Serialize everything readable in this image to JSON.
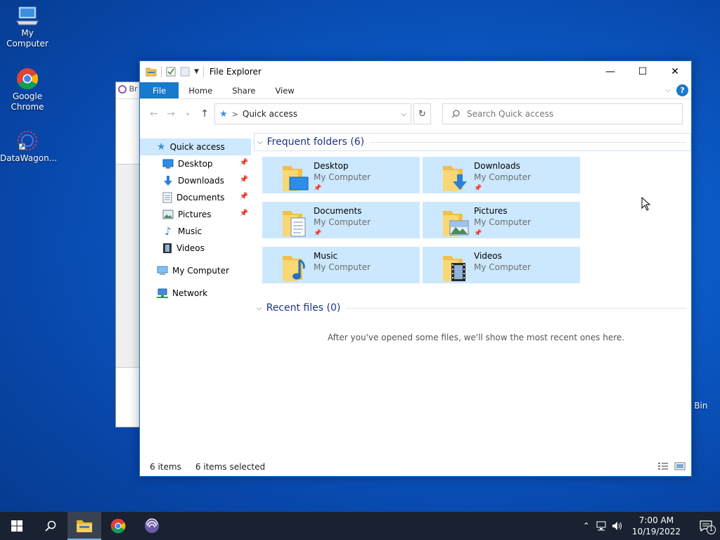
{
  "desktop": {
    "icons": [
      {
        "label": "My Computer"
      },
      {
        "label": "Google Chrome"
      },
      {
        "label": "DataWagon..."
      }
    ],
    "recycle_bin_label": "e Bin",
    "bg_window_title": "Br"
  },
  "window": {
    "title": "File Explorer",
    "controls": {
      "minimize": "—",
      "maximize": "☐",
      "close": "✕"
    },
    "ribbon_tabs": [
      "File",
      "Home",
      "Share",
      "View"
    ],
    "help": "?",
    "address": {
      "separator": ">",
      "location": "Quick access"
    },
    "search": {
      "placeholder": "Search Quick access"
    },
    "nav": {
      "items": [
        {
          "label": "Quick access",
          "icon": "star-icon",
          "selected": true
        },
        {
          "label": "Desktop",
          "icon": "desktop-icon",
          "pinned": true
        },
        {
          "label": "Downloads",
          "icon": "download-arrow-icon",
          "pinned": true
        },
        {
          "label": "Documents",
          "icon": "document-icon",
          "pinned": true
        },
        {
          "label": "Pictures",
          "icon": "picture-icon",
          "pinned": true
        },
        {
          "label": "Music",
          "icon": "music-note-icon"
        },
        {
          "label": "Videos",
          "icon": "film-icon"
        },
        {
          "label": "My Computer",
          "icon": "computer-icon"
        },
        {
          "label": "Network",
          "icon": "network-icon"
        }
      ]
    },
    "frequent": {
      "header": "Frequent folders (6)",
      "tiles": [
        {
          "name": "Desktop",
          "location": "My Computer",
          "pinned": true
        },
        {
          "name": "Downloads",
          "location": "My Computer",
          "pinned": true
        },
        {
          "name": "Documents",
          "location": "My Computer",
          "pinned": true
        },
        {
          "name": "Pictures",
          "location": "My Computer",
          "pinned": true
        },
        {
          "name": "Music",
          "location": "My Computer",
          "pinned": false
        },
        {
          "name": "Videos",
          "location": "My Computer",
          "pinned": false
        }
      ]
    },
    "recent": {
      "header": "Recent files (0)",
      "empty_message": "After you've opened some files, we'll show the most recent ones here."
    },
    "status": {
      "items": "6 items",
      "selected": "6 items selected"
    }
  },
  "taskbar": {
    "clock_time": "7:00 AM",
    "clock_date": "10/19/2022",
    "notification_count": "1"
  },
  "colors": {
    "accent": "#1979ca",
    "selection": "#cce8ff",
    "taskbar": "#1a2130",
    "group_header": "#1e3287"
  }
}
